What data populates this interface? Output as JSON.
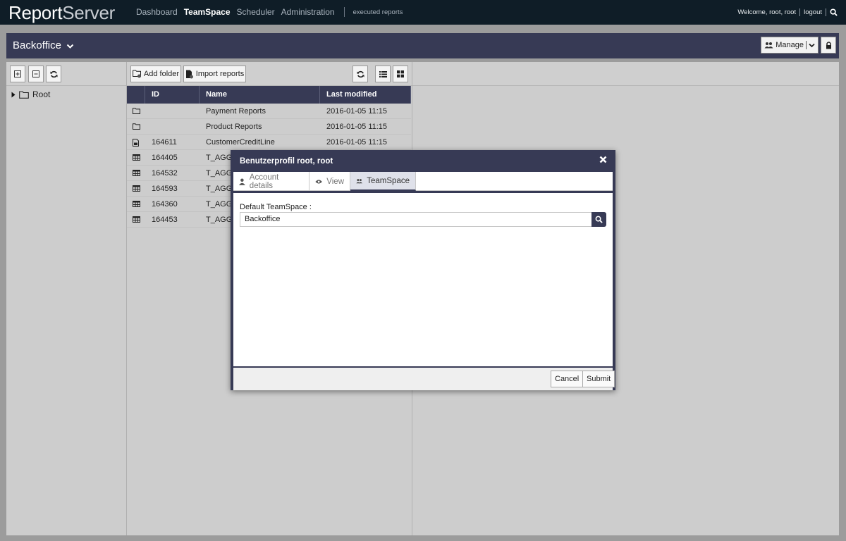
{
  "app": {
    "logo_bold": "Report",
    "logo_light": "Server",
    "nav": [
      "Dashboard",
      "TeamSpace",
      "Scheduler",
      "Administration"
    ],
    "executed_reports": "executed reports",
    "welcome": "Welcome, root, root",
    "logout": "logout"
  },
  "teamspace": {
    "title": "Backoffice",
    "manage_label": "Manage"
  },
  "tree": {
    "root_label": "Root"
  },
  "toolbar": {
    "add_folder": "Add folder",
    "import_reports": "Import reports"
  },
  "grid": {
    "columns": [
      "ID",
      "Name",
      "Last modified"
    ],
    "rows": [
      {
        "icon": "folder-icon",
        "id": "",
        "name": "Payment Reports",
        "modified": "2016-01-05 11:15"
      },
      {
        "icon": "folder-icon",
        "id": "",
        "name": "Product Reports",
        "modified": "2016-01-05 11:15"
      },
      {
        "icon": "report-icon",
        "id": "164611",
        "name": "CustomerCreditLine",
        "modified": "2016-01-05 11:15"
      },
      {
        "icon": "table-icon",
        "id": "164405",
        "name": "T_AGG",
        "modified": ""
      },
      {
        "icon": "table-icon",
        "id": "164532",
        "name": "T_AGG",
        "modified": ""
      },
      {
        "icon": "table-icon",
        "id": "164593",
        "name": "T_AGG",
        "modified": ""
      },
      {
        "icon": "table-icon",
        "id": "164360",
        "name": "T_AGG",
        "modified": ""
      },
      {
        "icon": "table-icon",
        "id": "164453",
        "name": "T_AGG",
        "modified": ""
      }
    ]
  },
  "dialog": {
    "title": "Benutzerprofil root, root",
    "tabs": [
      "Account details",
      "View",
      "TeamSpace"
    ],
    "field_label": "Default TeamSpace :",
    "field_value": "Backoffice",
    "cancel": "Cancel",
    "submit": "Submit"
  },
  "colors": {
    "topbar": "#0f1d27",
    "accent": "#373a55",
    "panel": "#cdcdcd"
  }
}
